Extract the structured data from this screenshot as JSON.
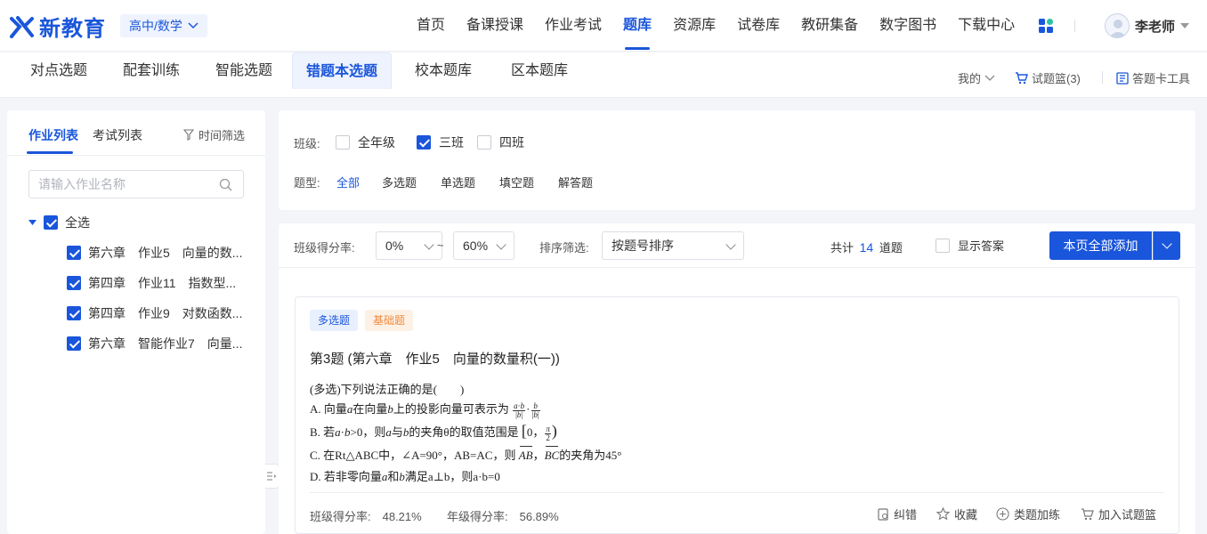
{
  "app": {
    "logo_text": "新教育",
    "subject": "高中/数学",
    "user_name": "李老师"
  },
  "nav": [
    "首页",
    "备课授课",
    "作业考试",
    "题库",
    "资源库",
    "试卷库",
    "教研集备",
    "数字图书",
    "下载中心"
  ],
  "nav_active": 3,
  "subtabs": [
    "对点选题",
    "配套训练",
    "智能选题",
    "错题本选题",
    "校本题库",
    "区本题库"
  ],
  "subtab_active": 3,
  "sub_right": {
    "mine": "我的",
    "basket": "试题篮(3)",
    "card_tool": "答题卡工具"
  },
  "sidebar": {
    "tab_homework": "作业列表",
    "tab_exam": "考试列表",
    "time_filter": "时间筛选",
    "search_placeholder": "请输入作业名称",
    "select_all": "全选",
    "items": [
      "第六章　作业5　向量的数...",
      "第四章　作业11　指数型...",
      "第四章　作业9　对数函数...",
      "第六章　智能作业7　向量..."
    ]
  },
  "filter": {
    "class_label": "班级:",
    "classes": [
      {
        "label": "全年级",
        "checked": false
      },
      {
        "label": "三班",
        "checked": true
      },
      {
        "label": "四班",
        "checked": false
      }
    ],
    "type_label": "题型:",
    "types": [
      "全部",
      "多选题",
      "单选题",
      "填空题",
      "解答题"
    ],
    "type_active": 0
  },
  "toolbar": {
    "rate_label": "班级得分率:",
    "rate_from": "0%",
    "tilde": "~",
    "rate_to": "60%",
    "sort_label": "排序筛选:",
    "sort_value": "按题号排序",
    "total_prefix": "共计",
    "total_count": "14",
    "total_suffix": "道题",
    "show_answer": "显示答案",
    "add_all": "本页全部添加"
  },
  "question": {
    "tag_type": "多选题",
    "tag_level": "基础题",
    "title": "第3题 (第六章　作业5　向量的数量积(一))",
    "stem": "(多选)下列说法正确的是(　　)",
    "A_pre": "A. 向量",
    "A_mid": "在向量",
    "A_post": "上的投影向量可表示为",
    "B_text": "B. 若",
    "B_mid": ">0，则",
    "B_mid2": "与",
    "B_post": "的夹角θ的取值范围是",
    "C_pre": "C. 在Rt△ABC中，∠A=90°，AB=AC，则",
    "C_post": "的夹角为45°",
    "D_pre": "D. 若非零向量",
    "D_mid": "和",
    "D_post": "满足a⊥b，则a·b=0",
    "class_rate": "班级得分率:　48.21%",
    "grade_rate": "年级得分率:　56.89%",
    "actions": [
      "纠错",
      "收藏",
      "类题加练",
      "加入试题篮"
    ]
  },
  "colors": {
    "brand": "#1a56db",
    "tag_orange": "#f08a3c",
    "bg": "#f3f5f9"
  }
}
